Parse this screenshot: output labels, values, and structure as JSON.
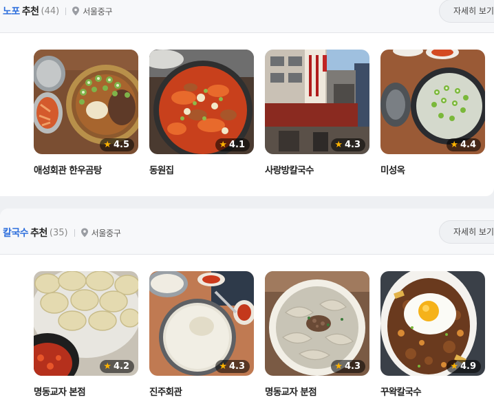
{
  "sections": [
    {
      "keyword": "노포",
      "rec_label": "추천",
      "count": "(44)",
      "location": "서울중구",
      "more_label": "자세히 보기",
      "items": [
        {
          "name": "애성회관 한우곰탕",
          "rating": "4.5"
        },
        {
          "name": "동원집",
          "rating": "4.1"
        },
        {
          "name": "사랑방칼국수",
          "rating": "4.3"
        },
        {
          "name": "미성옥",
          "rating": "4.4"
        }
      ]
    },
    {
      "keyword": "칼국수",
      "rec_label": "추천",
      "count": "(35)",
      "location": "서울중구",
      "more_label": "자세히 보기",
      "items": [
        {
          "name": "명동교자 본점",
          "rating": "4.2"
        },
        {
          "name": "진주회관",
          "rating": "4.3"
        },
        {
          "name": "명동교자 분점",
          "rating": "4.3"
        },
        {
          "name": "꾸왁칼국수",
          "rating": "4.9"
        }
      ]
    }
  ],
  "icons": {
    "location": "map-pin-icon",
    "rating": "star-icon"
  },
  "colors": {
    "keyword": "#2e6fdc",
    "star": "#ffb400"
  }
}
